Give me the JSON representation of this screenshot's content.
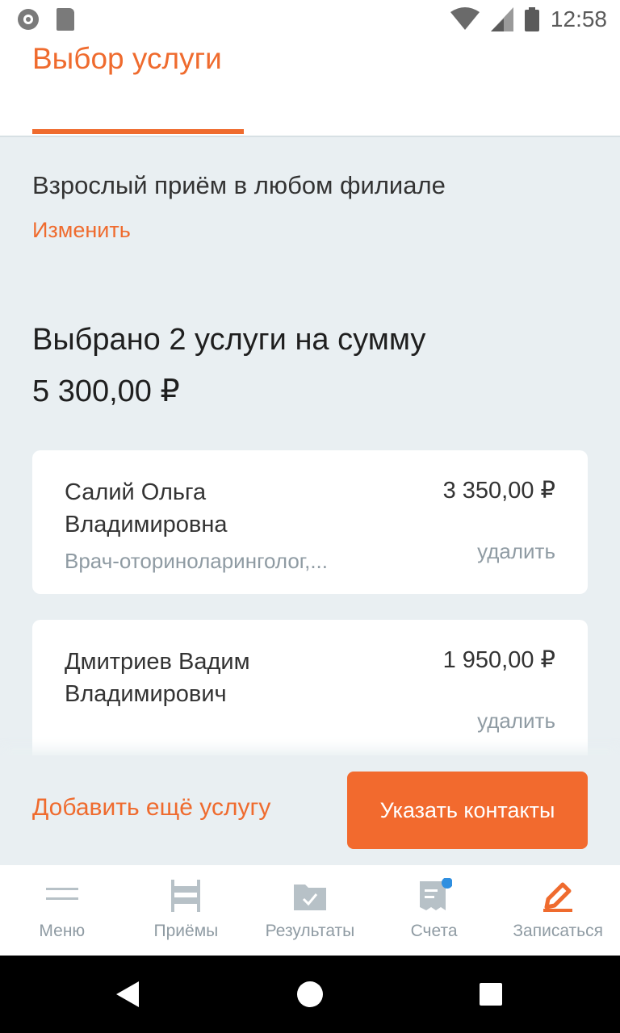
{
  "status_bar": {
    "time": "12:58",
    "icons": [
      "record-icon",
      "sd-card-icon",
      "wifi-icon",
      "signal-icon",
      "battery-icon"
    ]
  },
  "header": {
    "title": "Выбор услуги"
  },
  "service": {
    "name": "Взрослый приём в любом филиале",
    "change_label": "Изменить"
  },
  "summary": {
    "text": "Выбрано 2 услуги на сумму",
    "total": "5 300,00 ₽"
  },
  "cards": [
    {
      "doctor": "Салий Ольга Владимировна",
      "price": "3 350,00 ₽",
      "specialty": "Врач-оториноларинголог,...",
      "remove_label": "удалить"
    },
    {
      "doctor": "Дмитриев Вадим Владимирович",
      "price": "1 950,00 ₽",
      "remove_label": "удалить"
    }
  ],
  "actions": {
    "add_more": "Добавить ещё услугу",
    "contacts_button": "Указать контакты"
  },
  "tabs": [
    {
      "label": "Меню",
      "icon": "menu-icon"
    },
    {
      "label": "Приёмы",
      "icon": "appointments-icon"
    },
    {
      "label": "Результаты",
      "icon": "results-folder-icon"
    },
    {
      "label": "Счета",
      "icon": "bills-icon"
    },
    {
      "label": "Записаться",
      "icon": "pencil-icon"
    }
  ],
  "colors": {
    "accent": "#ef6b2e",
    "background": "#e9eff2",
    "muted": "#8f9ba3",
    "notification_dot": "#2f8fe0"
  }
}
